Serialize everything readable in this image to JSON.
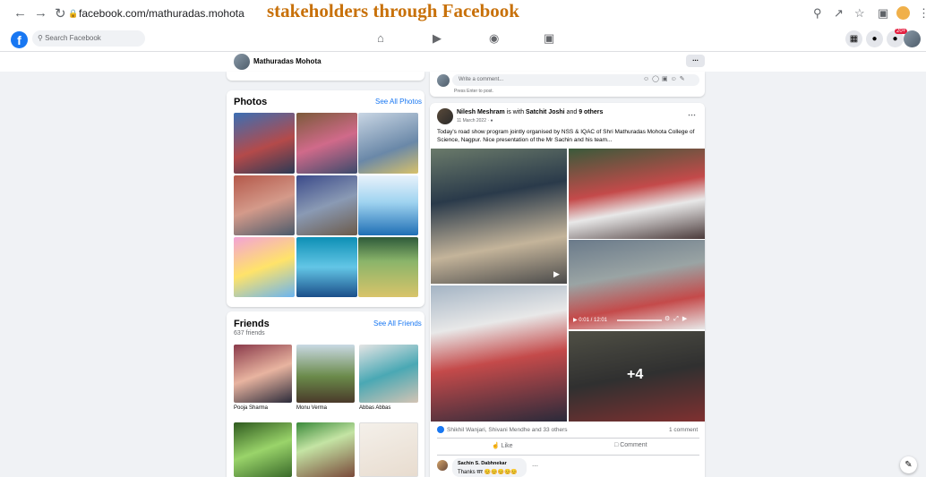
{
  "overlay": {
    "title": "stakeholders through Facebook"
  },
  "browser": {
    "url": "facebook.com/mathuradas.mohota"
  },
  "fb": {
    "search_placeholder": "Search Facebook",
    "notif_badge": "20+"
  },
  "profile": {
    "name": "Mathuradas Mohota",
    "more": "..."
  },
  "photos": {
    "title": "Photos",
    "see_all": "See All Photos"
  },
  "friends": {
    "title": "Friends",
    "see_all": "See All Friends",
    "count": "637 friends",
    "items": [
      "Pooja Sharma",
      "Monu Verma",
      "Abbas Abbas"
    ]
  },
  "comment_box": {
    "placeholder": "Write a comment...",
    "hint": "Press Enter to post."
  },
  "post": {
    "author": "Nilesh Meshram",
    "with_text": " is with ",
    "tagged1": "Satchit Joshi",
    "and_text": " and ",
    "tagged2": "9 others",
    "date": "11 March 2022 · ",
    "text": "Today's road show program jointly organised by NSS & IQAC of Shri Mathuradas Mohota College of Science, Nagpur. Nice presentation of the Mr Sachin and his team...",
    "video_time": "0:01 / 12:01",
    "more_photos": "+4",
    "reactions": "Shikhil Wanjari, Shivani Mendhe and 33 others",
    "comments_count": "1 comment",
    "like_label": "Like",
    "comment_label": "Comment",
    "commenter": "Sachin S. Dabhnekar",
    "comment_text": "Thanks सर",
    "comment_emoji": "😊😊😊😊😊"
  }
}
